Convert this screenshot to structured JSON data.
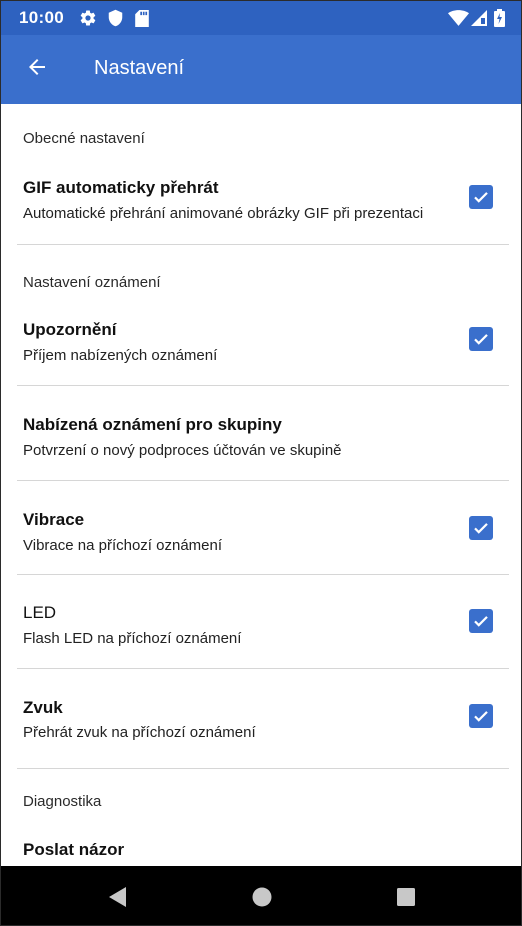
{
  "status_bar": {
    "time": "10:00",
    "icons": [
      "gear-icon",
      "shield-icon",
      "sd-card-icon",
      "wifi-icon",
      "signal-icon",
      "battery-icon"
    ]
  },
  "app_bar": {
    "back_icon": "arrow-left-icon",
    "title": "Nastavení"
  },
  "sections": {
    "general": {
      "header": "Obecné nastavení",
      "gif": {
        "title": "GIF automaticky přehrát",
        "subtitle": "Automatické přehrání animované obrázky GIF při prezentaci",
        "checked": true
      }
    },
    "notifications": {
      "header": "Nastavení oznámení",
      "alerts": {
        "title": "Upozornění",
        "subtitle": "Příjem nabízených oznámení",
        "checked": true
      },
      "group_push": {
        "title": "Nabízená oznámení pro skupiny",
        "subtitle": "Potvrzení o nový podproces účtován ve skupině"
      },
      "vibration": {
        "title": "Vibrace",
        "subtitle": "Vibrace na příchozí oznámení",
        "checked": true
      },
      "led": {
        "title": "LED",
        "subtitle": "Flash LED na příchozí oznámení",
        "checked": true
      },
      "sound": {
        "title": "Zvuk",
        "subtitle": "Přehrát zvuk na příchozí oznámení",
        "checked": true
      }
    },
    "diagnostics": {
      "header": "Diagnostika",
      "feedback": {
        "title": "Poslat názor"
      }
    }
  },
  "colors": {
    "status_bar": "#2e62c0",
    "app_bar": "#3a6fcc",
    "checkbox": "#3a6fcc",
    "nav_bar": "#000000"
  },
  "nav_bar": {
    "icons": [
      "back-triangle-icon",
      "home-circle-icon",
      "recents-square-icon"
    ]
  }
}
